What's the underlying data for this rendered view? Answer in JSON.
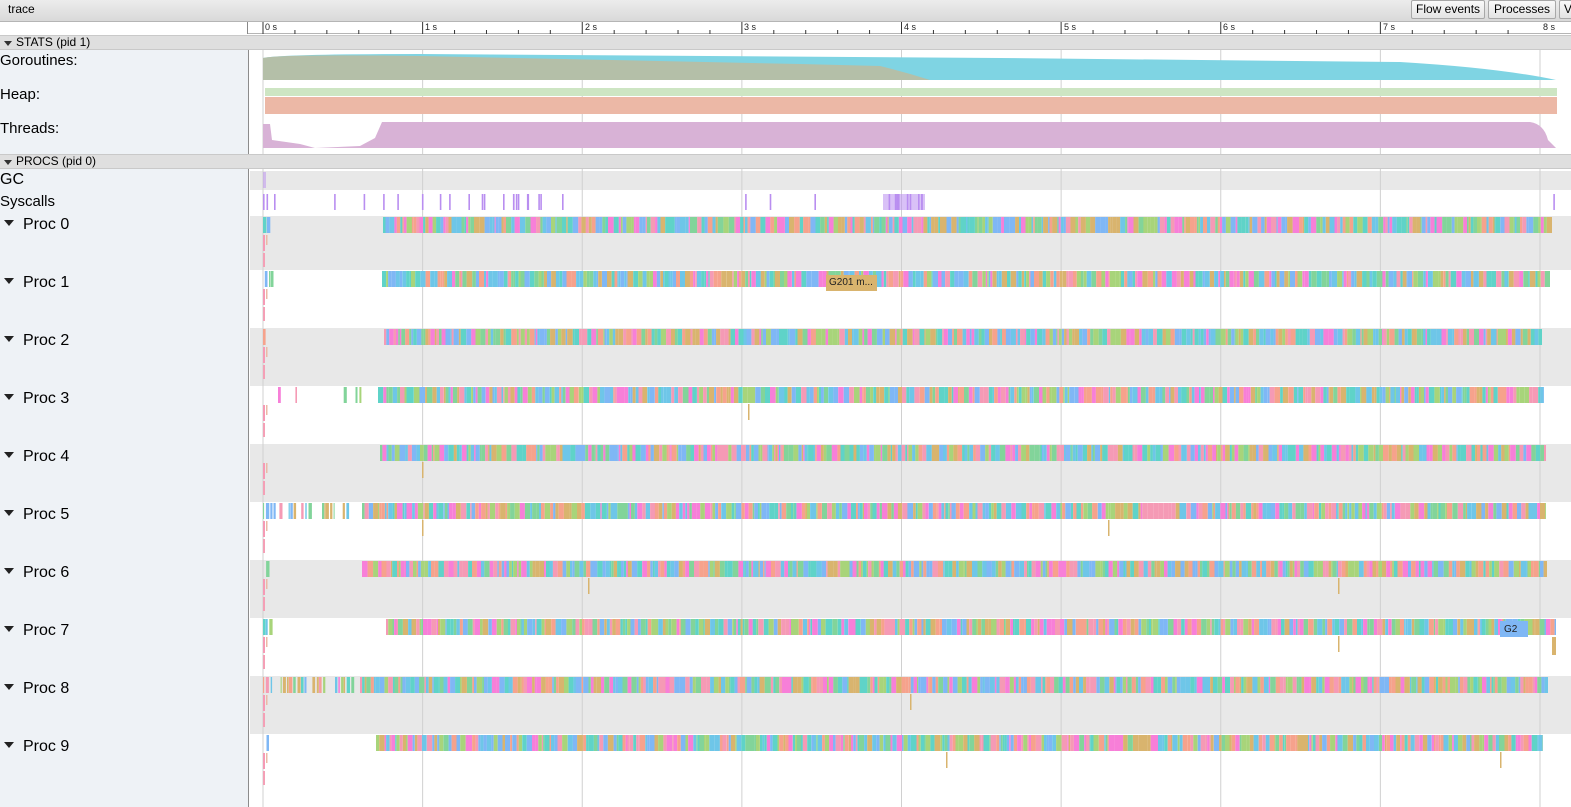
{
  "window": {
    "title": "trace"
  },
  "toolbar": {
    "flow_events_label": "Flow events",
    "processes_label": "Processes",
    "view_options_label": "V"
  },
  "ruler": {
    "ticks": [
      "0 s",
      "1 s",
      "2 s",
      "3 s",
      "4 s",
      "5 s",
      "6 s",
      "7 s",
      "8 s"
    ]
  },
  "stats_group": {
    "label": "STATS (pid 1)",
    "counters": [
      "Goroutines:",
      "Heap:",
      "Threads:"
    ]
  },
  "procs_group": {
    "label": "PROCS (pid 0)",
    "rows": [
      "GC",
      "Syscalls"
    ],
    "procs": [
      "Proc 0",
      "Proc 1",
      "Proc 2",
      "Proc 3",
      "Proc 4",
      "Proc 5",
      "Proc 6",
      "Proc 7",
      "Proc 8",
      "Proc 9"
    ]
  },
  "slices": {
    "proc1_label": "G201 m...",
    "proc7_label": "G2"
  },
  "colors": {
    "goroutines_grey": "#b4bfa8",
    "goroutines_cyan": "#7fd4e3",
    "heap_green": "#cde5c3",
    "heap_salmon": "#ecb8a6",
    "threads_purple": "#d8b2d6",
    "syscall_purple": "#b98ef0",
    "slice_palette": [
      "#6ec6e8",
      "#82d49a",
      "#f59ab5",
      "#f6a28c",
      "#a8d47a",
      "#f77fd8",
      "#7fb7f5",
      "#d9b46e",
      "#5fd3c8"
    ]
  }
}
